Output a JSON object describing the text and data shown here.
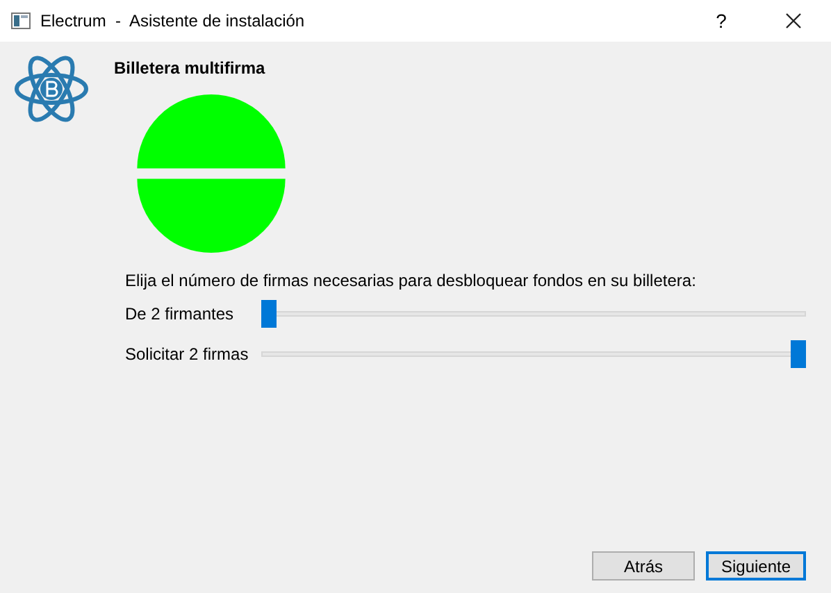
{
  "window": {
    "title": "Electrum  -  Asistente de instalación",
    "help": "?"
  },
  "heading": "Billetera multifirma",
  "prompt": "Elija el número de firmas necesarias para desbloquear fondos en su billetera:",
  "sliders": [
    {
      "label": "De 2 firmantes",
      "level": 0
    },
    {
      "label": "Solicitar 2 firmas",
      "level": 1
    }
  ],
  "buttons": [
    {
      "label": "Atrás",
      "focused": false
    },
    {
      "label": "Siguiente",
      "focused": true
    }
  ]
}
